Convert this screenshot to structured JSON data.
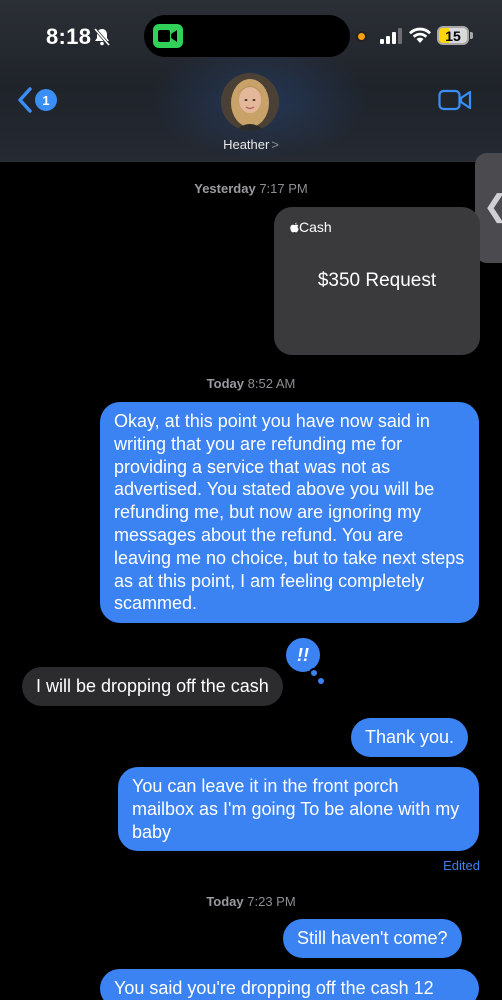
{
  "status_bar": {
    "time": "8:18",
    "battery": "15"
  },
  "header": {
    "back_badge": "1",
    "contact_name": "Heather",
    "contact_chevron": ">"
  },
  "side_tab": {
    "glyph": "❮"
  },
  "messages": [
    {
      "type": "timestamp",
      "day": "Yesterday",
      "time": "7:17 PM"
    },
    {
      "type": "cash_request",
      "brand": "Cash",
      "amount_text": "$350 Request"
    },
    {
      "type": "timestamp",
      "day": "Today",
      "time": "8:52 AM"
    },
    {
      "type": "outgoing",
      "text": "Okay, at this point you have now said in writing that you are refunding me for providing a service that was not as advertised. You stated above you will be refunding me, but now are ignoring my messages about the refund. You are leaving me no choice, but to take next steps as at this point, I am feeling completely scammed."
    },
    {
      "type": "incoming",
      "text": "I will be dropping off the cash",
      "reaction": "!!"
    },
    {
      "type": "outgoing",
      "text": "Thank you."
    },
    {
      "type": "outgoing",
      "text": "You can leave it in the front porch mailbox  as I'm going To be alone with my baby",
      "status": "Edited"
    },
    {
      "type": "timestamp",
      "day": "Today",
      "time": "7:23 PM"
    },
    {
      "type": "outgoing",
      "text": "Still haven't come?"
    },
    {
      "type": "outgoing",
      "text": "You said you're dropping off the cash 12"
    }
  ],
  "colors": {
    "outgoing_bubble": "#3b82f2",
    "incoming_bubble": "#2c2c2e",
    "accent": "#3a8ef6"
  }
}
